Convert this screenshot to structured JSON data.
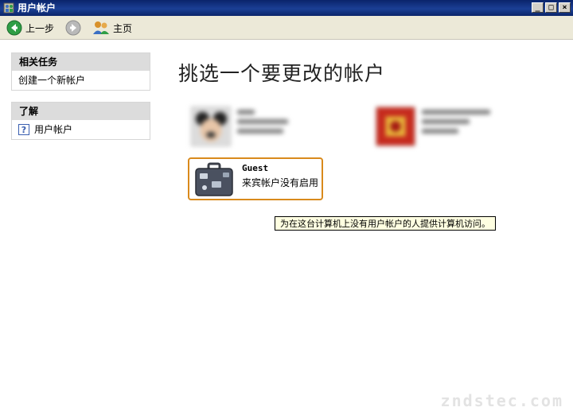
{
  "window": {
    "title": "用户帐户",
    "buttons": {
      "minimize": "_",
      "maximize": "□",
      "close": "×"
    }
  },
  "toolbar": {
    "back_label": "上一步",
    "home_label": "主页"
  },
  "sidebar": {
    "related_tasks": {
      "header": "相关任务",
      "items": [
        "创建一个新帐户"
      ]
    },
    "learn": {
      "header": "了解",
      "items": [
        "用户帐户"
      ]
    }
  },
  "main": {
    "title": "挑选一个要更改的帐户",
    "guest": {
      "name": "Guest",
      "status": "来宾帐户没有启用",
      "selected": true,
      "border_color": "#d98a1c"
    },
    "tooltip": "为在这台计算机上没有用户帐户的人提供计算机访问。"
  },
  "watermark": "zndstec.com",
  "colors": {
    "titlebar": "#0a246a",
    "toolbar": "#ece9d8",
    "panel_header": "#dcdcdc",
    "tooltip_bg": "#ffffe1"
  }
}
